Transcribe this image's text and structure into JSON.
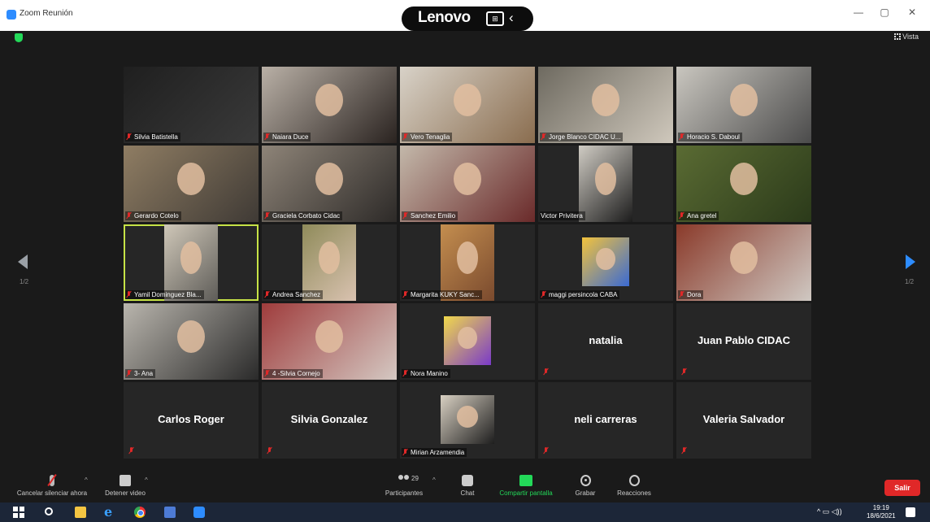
{
  "window": {
    "title": "Zoom Reunión",
    "minimize": "—",
    "maximize": "▢",
    "close": "✕"
  },
  "overlay": {
    "brand": "Lenovo",
    "back_glyph": "‹"
  },
  "meeting": {
    "view_label": "Vista",
    "page_left": "1/2",
    "page_right": "1/2"
  },
  "participants": [
    {
      "name": "Silvia Batistella",
      "video": true,
      "muted": true
    },
    {
      "name": "Naiara Duce",
      "video": true,
      "muted": true
    },
    {
      "name": "Vero Tenaglia",
      "video": true,
      "muted": true
    },
    {
      "name": "Jorge Blanco CIDAC U...",
      "video": true,
      "muted": true
    },
    {
      "name": "Horacio S. Daboul",
      "video": true,
      "muted": true
    },
    {
      "name": "Gerardo Cotelo",
      "video": true,
      "muted": true
    },
    {
      "name": "Graciela Corbato  Cidac",
      "video": true,
      "muted": true
    },
    {
      "name": "Sanchez Emilio",
      "video": true,
      "muted": true
    },
    {
      "name": "Victor Privitera",
      "video": true,
      "muted": false
    },
    {
      "name": "Ana gretel",
      "video": true,
      "muted": true
    },
    {
      "name": "Yamil Dominguez Bla...",
      "video": true,
      "muted": true,
      "active_speaker": true
    },
    {
      "name": "Andrea Sanchez",
      "video": true,
      "muted": true
    },
    {
      "name": "Margarita KUKY Sanc...",
      "video": true,
      "muted": true
    },
    {
      "name": "maggi persincola CABA",
      "video": true,
      "muted": true
    },
    {
      "name": "Dora",
      "video": true,
      "muted": true
    },
    {
      "name": "3- Ana",
      "video": true,
      "muted": true
    },
    {
      "name": "4 -Silvia Cornejo",
      "video": true,
      "muted": true
    },
    {
      "name": "Nora Manino",
      "video": true,
      "muted": true
    },
    {
      "name": "natalia",
      "video": false,
      "muted": true
    },
    {
      "name": "Juan Pablo CIDAC",
      "video": false,
      "muted": true
    },
    {
      "name": "Carlos Roger",
      "video": false,
      "muted": true
    },
    {
      "name": "Silvia Gonzalez",
      "video": false,
      "muted": true
    },
    {
      "name": "Mirian Arzamendia",
      "video": true,
      "muted": true
    },
    {
      "name": "neli carreras",
      "video": false,
      "muted": true
    },
    {
      "name": "Valeria Salvador",
      "video": false,
      "muted": true
    }
  ],
  "toolbar": {
    "mute_label": "Cancelar silenciar ahora",
    "video_label": "Detener video",
    "participants_label": "Participantes",
    "participants_count": "29",
    "chat_label": "Chat",
    "share_label": "Compartir pantalla",
    "record_label": "Grabar",
    "reactions_label": "Reacciones",
    "leave_label": "Salir",
    "caret": "^"
  },
  "taskbar": {
    "tray": "^ ▭ ◁))",
    "time": "19:19",
    "date": "18/6/2021",
    "edge_glyph": "e"
  },
  "colors": {
    "zoom_blue": "#2d8cff",
    "share_green": "#23d959",
    "leave_red": "#e02828",
    "active_speaker": "#c6e246"
  }
}
